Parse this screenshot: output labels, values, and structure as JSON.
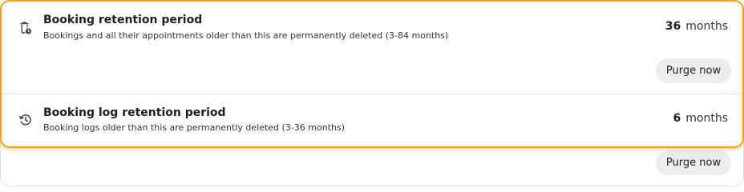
{
  "settings": [
    {
      "icon": "trash-clock-icon",
      "title": "Booking retention period",
      "description": "Bookings and all their appointments older than this are permanently deleted (3-84 months)",
      "value": "36",
      "unit": "months",
      "button_label": "Purge now"
    },
    {
      "icon": "history-icon",
      "title": "Booking log retention period",
      "description": "Booking logs older than this are permanently deleted (3-36 months)",
      "value": "6",
      "unit": "months",
      "button_label": "Purge now"
    }
  ],
  "colors": {
    "focus_ring": "#f5a017",
    "button_bg": "#ececec",
    "border": "#dcdcdc"
  }
}
